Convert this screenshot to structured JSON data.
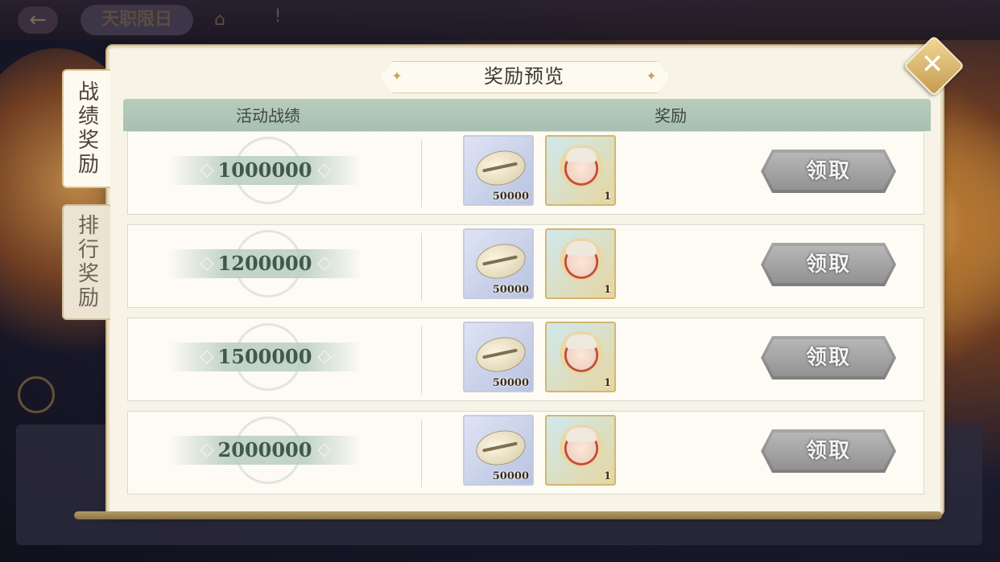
{
  "background": {
    "title_label": "天职限日",
    "back_icon": "back-arrow-icon",
    "home_icon": "home-icon",
    "alert_icon": "alert-icon"
  },
  "dialog": {
    "title": "奖励预览",
    "close_icon": "close-icon"
  },
  "side_tabs": [
    {
      "label": "战绩奖励",
      "active": true
    },
    {
      "label": "排行奖励",
      "active": false
    }
  ],
  "table": {
    "columns": [
      "活动战绩",
      "奖励"
    ],
    "rows": [
      {
        "score": "1000000",
        "rewards": [
          {
            "icon": "shell-currency-icon",
            "count": "50000"
          },
          {
            "icon": "character-card-icon",
            "count": "1"
          }
        ],
        "button": "领取"
      },
      {
        "score": "1200000",
        "rewards": [
          {
            "icon": "shell-currency-icon",
            "count": "50000"
          },
          {
            "icon": "character-card-icon",
            "count": "1"
          }
        ],
        "button": "领取"
      },
      {
        "score": "1500000",
        "rewards": [
          {
            "icon": "shell-currency-icon",
            "count": "50000"
          },
          {
            "icon": "character-card-icon",
            "count": "1"
          }
        ],
        "button": "领取"
      },
      {
        "score": "2000000",
        "rewards": [
          {
            "icon": "shell-currency-icon",
            "count": "50000"
          },
          {
            "icon": "character-card-icon",
            "count": "1"
          }
        ],
        "button": "领取"
      }
    ]
  },
  "colors": {
    "panel": "#f7f3e6",
    "header": "#b8ccbe",
    "score_text": "#3f5a4b",
    "claim_button_disabled": "#9a9a9a",
    "close_button": "#d9b46a"
  }
}
